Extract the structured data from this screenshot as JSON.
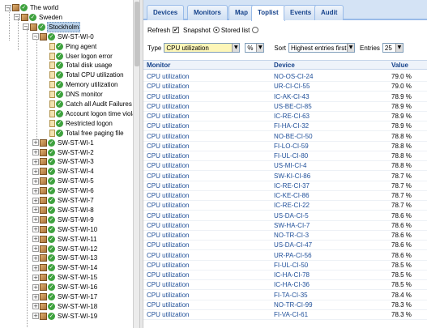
{
  "tree": {
    "root": "The world",
    "country": "Sweden",
    "city": "Stockholm",
    "expanded_server": "SW-ST-WI-0",
    "checks": [
      "Ping agent",
      "User logon error",
      "Total disk usage",
      "Total CPU utilization",
      "Memory utilization",
      "DNS monitor",
      "Catch all Audit Failures",
      "Account logon time viola",
      "Restricted logon",
      "Total free paging file"
    ],
    "servers": [
      "SW-ST-WI-1",
      "SW-ST-WI-2",
      "SW-ST-WI-3",
      "SW-ST-WI-4",
      "SW-ST-WI-5",
      "SW-ST-WI-6",
      "SW-ST-WI-7",
      "SW-ST-WI-8",
      "SW-ST-WI-9",
      "SW-ST-WI-10",
      "SW-ST-WI-11",
      "SW-ST-WI-12",
      "SW-ST-WI-13",
      "SW-ST-WI-14",
      "SW-ST-WI-15",
      "SW-ST-WI-16",
      "SW-ST-WI-17",
      "SW-ST-WI-18",
      "SW-ST-WI-19"
    ]
  },
  "tabs": [
    "Devices",
    "Monitors",
    "Map",
    "Toplist",
    "Events",
    "Audit"
  ],
  "active_tab": "Toplist",
  "toolbar": {
    "refresh": "Refresh",
    "snapshot": "Snapshot",
    "stored_list": "Stored list",
    "type_label": "Type",
    "type_value": "CPU utilization",
    "unit_value": "%",
    "sort_label": "Sort",
    "sort_value": "Highest entries first",
    "entries_label": "Entries",
    "entries_value": "25"
  },
  "grid": {
    "headers": {
      "monitor": "Monitor",
      "device": "Device",
      "value": "Value"
    },
    "rows": [
      {
        "monitor": "CPU utilization",
        "device": "NO-OS-CI-24",
        "value": "79.0 %"
      },
      {
        "monitor": "CPU utilization",
        "device": "UR-CI-CI-55",
        "value": "79.0 %"
      },
      {
        "monitor": "CPU utilization",
        "device": "IC-AK-CI-43",
        "value": "78.9 %"
      },
      {
        "monitor": "CPU utilization",
        "device": "US-BE-CI-85",
        "value": "78.9 %"
      },
      {
        "monitor": "CPU utilization",
        "device": "IC-RE-CI-63",
        "value": "78.9 %"
      },
      {
        "monitor": "CPU utilization",
        "device": "FI-HA-CI-32",
        "value": "78.9 %"
      },
      {
        "monitor": "CPU utilization",
        "device": "NO-BE-CI-50",
        "value": "78.8 %"
      },
      {
        "monitor": "CPU utilization",
        "device": "FI-LO-CI-59",
        "value": "78.8 %"
      },
      {
        "monitor": "CPU utilization",
        "device": "FI-UL-CI-80",
        "value": "78.8 %"
      },
      {
        "monitor": "CPU utilization",
        "device": "US-MI-CI-4",
        "value": "78.8 %"
      },
      {
        "monitor": "CPU utilization",
        "device": "SW-KI-CI-86",
        "value": "78.7 %"
      },
      {
        "monitor": "CPU utilization",
        "device": "IC-RE-CI-37",
        "value": "78.7 %"
      },
      {
        "monitor": "CPU utilization",
        "device": "IC-KE-CI-86",
        "value": "78.7 %"
      },
      {
        "monitor": "CPU utilization",
        "device": "IC-RE-CI-22",
        "value": "78.7 %"
      },
      {
        "monitor": "CPU utilization",
        "device": "US-DA-CI-5",
        "value": "78.6 %"
      },
      {
        "monitor": "CPU utilization",
        "device": "SW-HA-CI-7",
        "value": "78.6 %"
      },
      {
        "monitor": "CPU utilization",
        "device": "NO-TR-CI-3",
        "value": "78.6 %"
      },
      {
        "monitor": "CPU utilization",
        "device": "US-DA-CI-47",
        "value": "78.6 %"
      },
      {
        "monitor": "CPU utilization",
        "device": "UR-PA-CI-56",
        "value": "78.6 %"
      },
      {
        "monitor": "CPU utilization",
        "device": "FI-UL-CI-50",
        "value": "78.5 %"
      },
      {
        "monitor": "CPU utilization",
        "device": "IC-HA-CI-78",
        "value": "78.5 %"
      },
      {
        "monitor": "CPU utilization",
        "device": "IC-HA-CI-36",
        "value": "78.5 %"
      },
      {
        "monitor": "CPU utilization",
        "device": "FI-TA-CI-35",
        "value": "78.4 %"
      },
      {
        "monitor": "CPU utilization",
        "device": "NO-TR-CI-99",
        "value": "78.3 %"
      },
      {
        "monitor": "CPU utilization",
        "device": "FI-VA-CI-61",
        "value": "78.3 %"
      }
    ]
  }
}
